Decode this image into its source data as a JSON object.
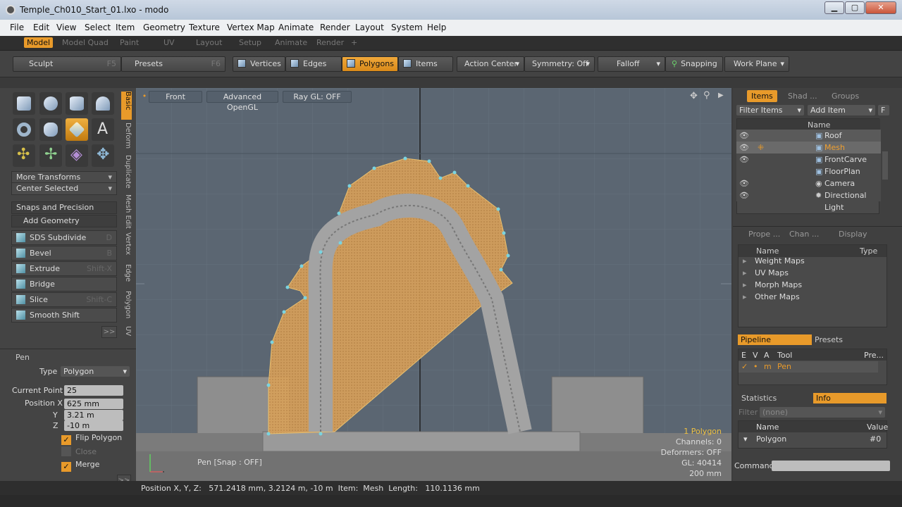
{
  "window": {
    "title": "Temple_Ch010_Start_01.lxo - modo",
    "min": "▁",
    "max": "▢",
    "close": "✕"
  },
  "menu": [
    "File",
    "Edit",
    "View",
    "Select",
    "Item",
    "Geometry",
    "Texture",
    "Vertex Map",
    "Animate",
    "Render",
    "Layout",
    "System",
    "Help"
  ],
  "layout_tabs": [
    "Model",
    "Model Quad",
    "Paint",
    "UV",
    "Layout",
    "Setup",
    "Animate",
    "Render",
    "+"
  ],
  "toolbar": {
    "sculpt": "Sculpt",
    "sculpt_key": "F5",
    "presets": "Presets",
    "presets_key": "F6",
    "vertices": "Vertices",
    "edges": "Edges",
    "polygons": "Polygons",
    "items": "Items",
    "action_center": "Action Center",
    "symmetry": "Symmetry: Off",
    "falloff": "Falloff",
    "snapping": "Snapping",
    "work_plane": "Work Plane"
  },
  "left": {
    "more_transforms": "More Transforms",
    "center_selected": "Center Selected",
    "snaps": "Snaps and Precision",
    "add_geometry": "Add Geometry",
    "tools": [
      {
        "label": "SDS Subdivide",
        "key": "D"
      },
      {
        "label": "Bevel",
        "key": "B"
      },
      {
        "label": "Extrude",
        "key": "Shift-X"
      },
      {
        "label": "Bridge",
        "key": ""
      },
      {
        "label": "Slice",
        "key": "Shift-C"
      },
      {
        "label": "Smooth Shift",
        "key": ""
      }
    ],
    "more": ">>",
    "vtabs": [
      "Basic",
      "Deform",
      "Duplicate",
      "Mesh Edit",
      "Vertex",
      "Edge",
      "Polygon",
      "UV"
    ],
    "pen": {
      "title": "Pen",
      "type_label": "Type",
      "type_value": "Polygon",
      "current_point_label": "Current Point",
      "current_point": "25",
      "position_x_label": "Position X",
      "x": "625 mm",
      "y_label": "Y",
      "y": "3.21 m",
      "z_label": "Z",
      "z": "-10 m",
      "flip": "Flip Polygon",
      "close": "Close",
      "merge": "Merge",
      "more": ">>"
    }
  },
  "viewport": {
    "view": "Front",
    "renderer": "Advanced OpenGL",
    "raygl": "Ray GL: OFF",
    "tool_hint": "Pen  [Snap : OFF]",
    "info": {
      "sel": "1 Polygon",
      "channels": "Channels: 0",
      "deformers": "Deformers: OFF",
      "gl": "GL: 40414",
      "scale": "200 mm"
    }
  },
  "right": {
    "tabs": [
      "Items",
      "Shad ...",
      "Groups"
    ],
    "filter": "Filter Items",
    "add_item": "Add Item",
    "f_btn": "F",
    "name_col": "Name",
    "items": [
      "Roof",
      "Mesh",
      "FrontCarve",
      "FloorPlan",
      "Camera",
      "Directional Light"
    ],
    "prop_tabs": [
      "Prope ...",
      "Chan ...",
      "Display"
    ],
    "vmap_cols": {
      "name": "Name",
      "type": "Type"
    },
    "vmaps": [
      "Weight Maps",
      "UV Maps",
      "Morph Maps",
      "Other Maps"
    ],
    "pipeline": "Pipeline",
    "presets": "Presets",
    "pipe_cols": {
      "e": "E",
      "v": "V",
      "a": "A",
      "tool": "Tool",
      "pre": "Pre..."
    },
    "pipe_row": {
      "check": "✓",
      "dot": "•",
      "m": "m",
      "tool": "Pen"
    },
    "stats": "Statistics",
    "info": "Info",
    "filter_label": "Filter",
    "filter_value": "(none)",
    "info_cols": {
      "name": "Name",
      "value": "Value"
    },
    "info_row": {
      "name": "Polygon",
      "value": "#0"
    },
    "command": "Command"
  },
  "status": "Position X, Y, Z:   571.2418 mm, 3.2124 m, -10 m  Item:  Mesh  Length:   110.1136 mm"
}
